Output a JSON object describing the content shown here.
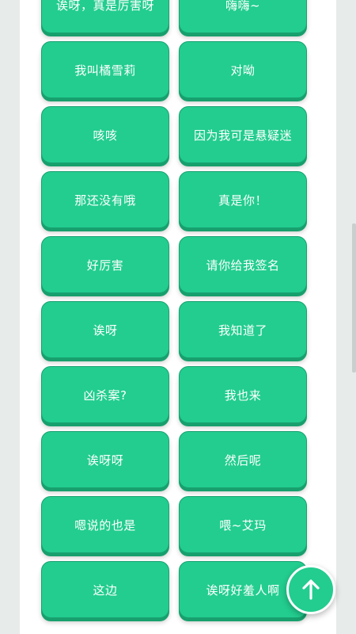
{
  "buttons": [
    {
      "label": "诶呀，真是厉害呀"
    },
    {
      "label": "嗨嗨~"
    },
    {
      "label": "我叫橘雪莉"
    },
    {
      "label": "对呦"
    },
    {
      "label": "咳咳"
    },
    {
      "label": "因为我可是悬疑迷"
    },
    {
      "label": "那还没有哦"
    },
    {
      "label": "真是你！"
    },
    {
      "label": "好厉害"
    },
    {
      "label": "请你给我签名"
    },
    {
      "label": "诶呀"
    },
    {
      "label": "我知道了"
    },
    {
      "label": "凶杀案?"
    },
    {
      "label": "我也来"
    },
    {
      "label": "诶呀呀"
    },
    {
      "label": "然后呢"
    },
    {
      "label": "嗯说的也是"
    },
    {
      "label": "喂~艾玛"
    },
    {
      "label": "这边"
    },
    {
      "label": "诶呀好羞人啊"
    }
  ],
  "fab": {
    "icon": "arrow-up-icon"
  },
  "colors": {
    "accent": "#22cd8f",
    "accent_dark": "#17a06d",
    "background": "#e7ebea"
  }
}
